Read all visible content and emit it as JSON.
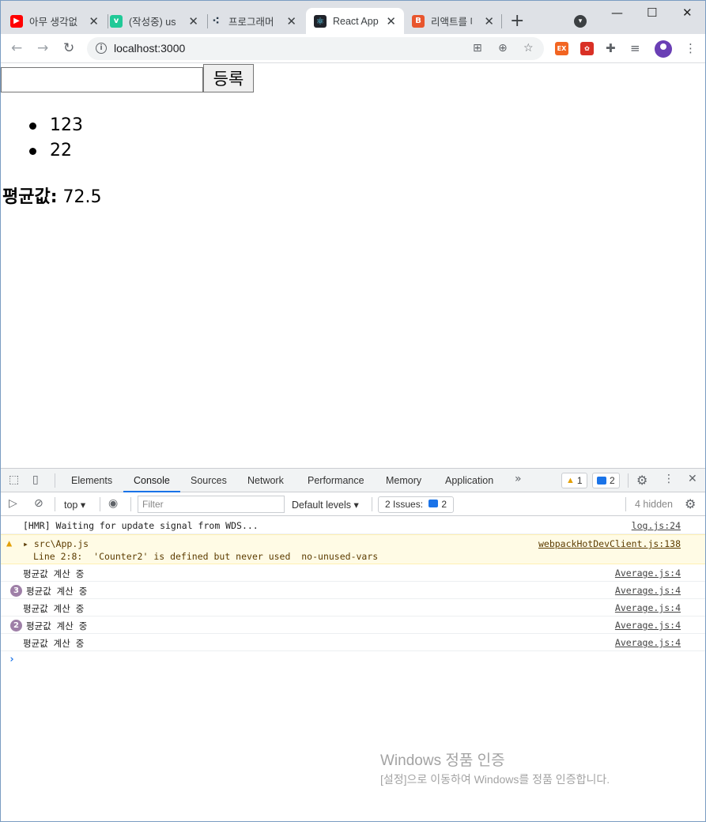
{
  "browser": {
    "tabs": [
      {
        "title": "아무 생각없",
        "favicon": "youtube-icon",
        "color": "#ff0000"
      },
      {
        "title": "(작성중) us",
        "favicon": "velog-icon",
        "color": "#20c997"
      },
      {
        "title": "프로그래머",
        "favicon": "programmers-icon",
        "color": "#263747"
      },
      {
        "title": "React App",
        "favicon": "react-icon",
        "color": "#61dafb"
      },
      {
        "title": "리액트를 다",
        "favicon": "blog-icon",
        "color": "#e8552d"
      }
    ],
    "url": "localhost:3000"
  },
  "page": {
    "input_value": "",
    "register_button": "등록",
    "items": [
      "123",
      "22"
    ],
    "average_label": "평균값:",
    "average_value": "72.5"
  },
  "devtools": {
    "tabs": [
      "Elements",
      "Console",
      "Sources",
      "Network",
      "Performance",
      "Memory",
      "Application"
    ],
    "active_tab": "Console",
    "warn_count": "1",
    "msg_count": "2",
    "context": "top",
    "filter_placeholder": "Filter",
    "levels": "Default levels",
    "issues_label": "2 Issues:",
    "issues_count": "2",
    "hidden": "4 hidden",
    "logs": [
      {
        "text": "[HMR] Waiting for update signal from WDS...",
        "source": "log.js:24"
      },
      {
        "text": "src\\App.js",
        "text2": "Line 2:8:  'Counter2' is defined but never used  no-unused-vars",
        "source": "webpackHotDevClient.js:138"
      },
      {
        "text": "평균값 계산 중",
        "source": "Average.js:4"
      },
      {
        "text": "평균값 계산 중",
        "source": "Average.js:4",
        "count": "3"
      },
      {
        "text": "평균값 계산 중",
        "source": "Average.js:4"
      },
      {
        "text": "평균값 계산 중",
        "source": "Average.js:4",
        "count": "2"
      },
      {
        "text": "평균값 계산 중",
        "source": "Average.js:4"
      }
    ]
  },
  "watermark": {
    "line1": "Windows 정품 인증",
    "line2": "[설정]으로 이동하여 Windows를 정품 인증합니다."
  }
}
